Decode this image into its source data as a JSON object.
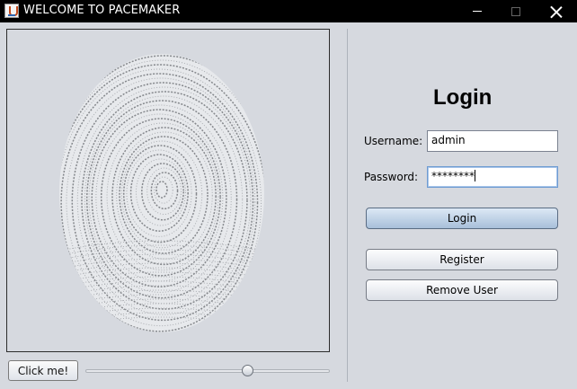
{
  "window": {
    "title": "WELCOME TO PACEMAKER",
    "controls": {
      "minimize": "minimize-icon",
      "maximize": "maximize-icon",
      "close": "close-icon"
    }
  },
  "image_panel": {
    "content": "fingerprint-image"
  },
  "controls": {
    "click_button_label": "Click me!",
    "slider_value": 0.67
  },
  "login": {
    "title": "Login",
    "username_label": "Username:",
    "username_value": "admin",
    "password_label": "Password:",
    "password_value": "********",
    "login_button": "Login",
    "register_button": "Register",
    "remove_user_button": "Remove User"
  },
  "colors": {
    "titlebar": "#000000",
    "background": "#d6d9df",
    "login_button_top": "#dce8f5",
    "login_button_bottom": "#a8c0da"
  }
}
